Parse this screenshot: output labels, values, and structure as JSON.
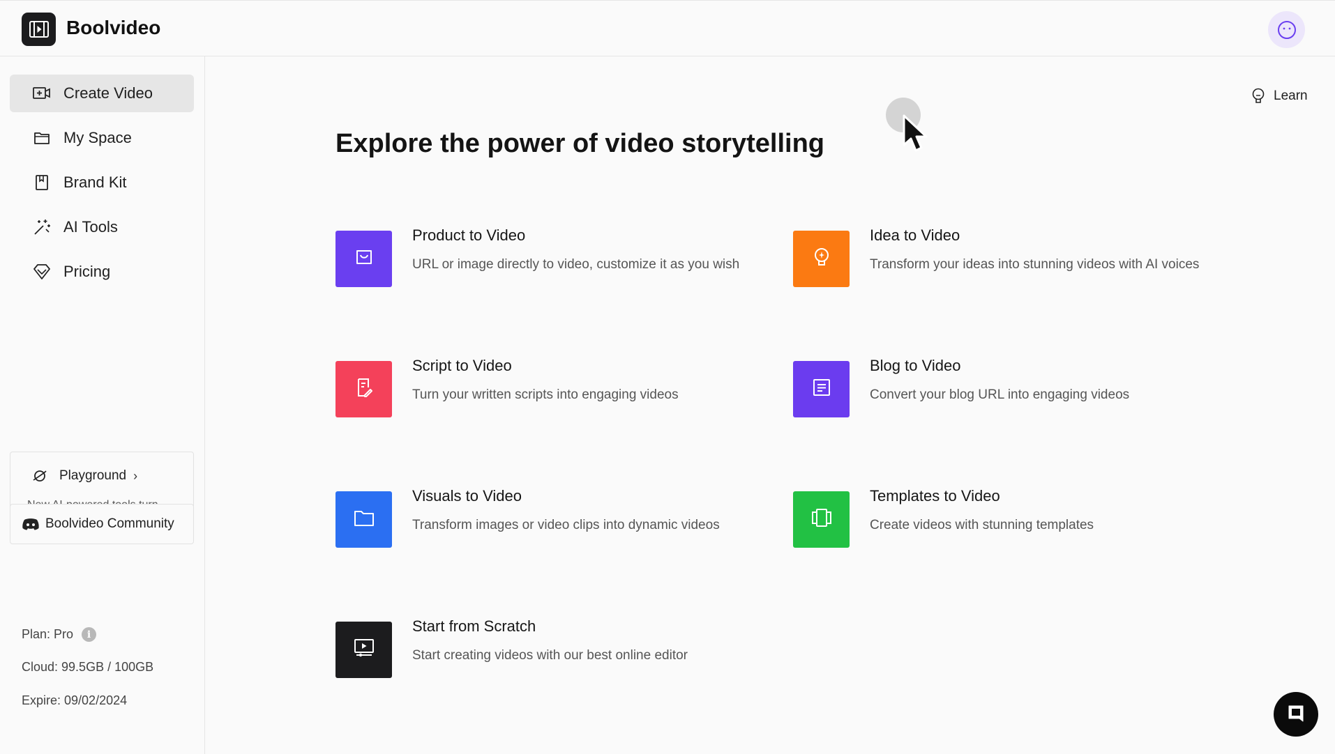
{
  "app": {
    "name": "Boolvideo"
  },
  "sidebar": {
    "items": [
      {
        "label": "Create Video",
        "icon": "video-add-icon",
        "active": true
      },
      {
        "label": "My Space",
        "icon": "folder-icon",
        "active": false
      },
      {
        "label": "Brand Kit",
        "icon": "bookmark-icon",
        "active": false
      },
      {
        "label": "AI Tools",
        "icon": "magic-wand-icon",
        "active": false
      },
      {
        "label": "Pricing",
        "icon": "diamond-icon",
        "active": false
      }
    ],
    "playground": {
      "label": "Playground",
      "description": "New AI-powered tools turn imagination into innovation"
    },
    "community": {
      "label": "Boolvideo Community"
    },
    "plan": {
      "plan": "Plan: Pro",
      "cloud": "Cloud: 99.5GB / 100GB",
      "expire": "Expire: 09/02/2024"
    }
  },
  "header": {
    "learn_label": "Learn"
  },
  "main": {
    "headline": "Explore the power of video storytelling",
    "cards": [
      {
        "title": "Product to Video",
        "desc": "URL or image directly to video, customize it as you wish",
        "color": "#6a3ff0",
        "icon": "shopping-bag-icon"
      },
      {
        "title": "Idea to Video",
        "desc": "Transform your ideas into stunning videos with AI voices",
        "color": "#fb7a12",
        "icon": "lightbulb-icon"
      },
      {
        "title": "Script to Video",
        "desc": "Turn your written scripts into engaging videos",
        "color": "#f4415a",
        "icon": "script-edit-icon"
      },
      {
        "title": "Blog to Video",
        "desc": "Convert your blog URL into engaging videos",
        "color": "#6b3cef",
        "icon": "document-icon"
      },
      {
        "title": "Visuals to Video",
        "desc": "Transform images or video clips into dynamic videos",
        "color": "#2b6ff2",
        "icon": "folder-icon"
      },
      {
        "title": "Templates to Video",
        "desc": "Create videos with stunning templates",
        "color": "#22c144",
        "icon": "templates-icon"
      },
      {
        "title": "Start from Scratch",
        "desc": "Start creating videos with our best online editor",
        "color": "#1c1c1e",
        "icon": "monitor-play-icon"
      }
    ]
  },
  "colors": {
    "accent": "#6a3ff0",
    "active_bg": "#e6e6e6"
  }
}
